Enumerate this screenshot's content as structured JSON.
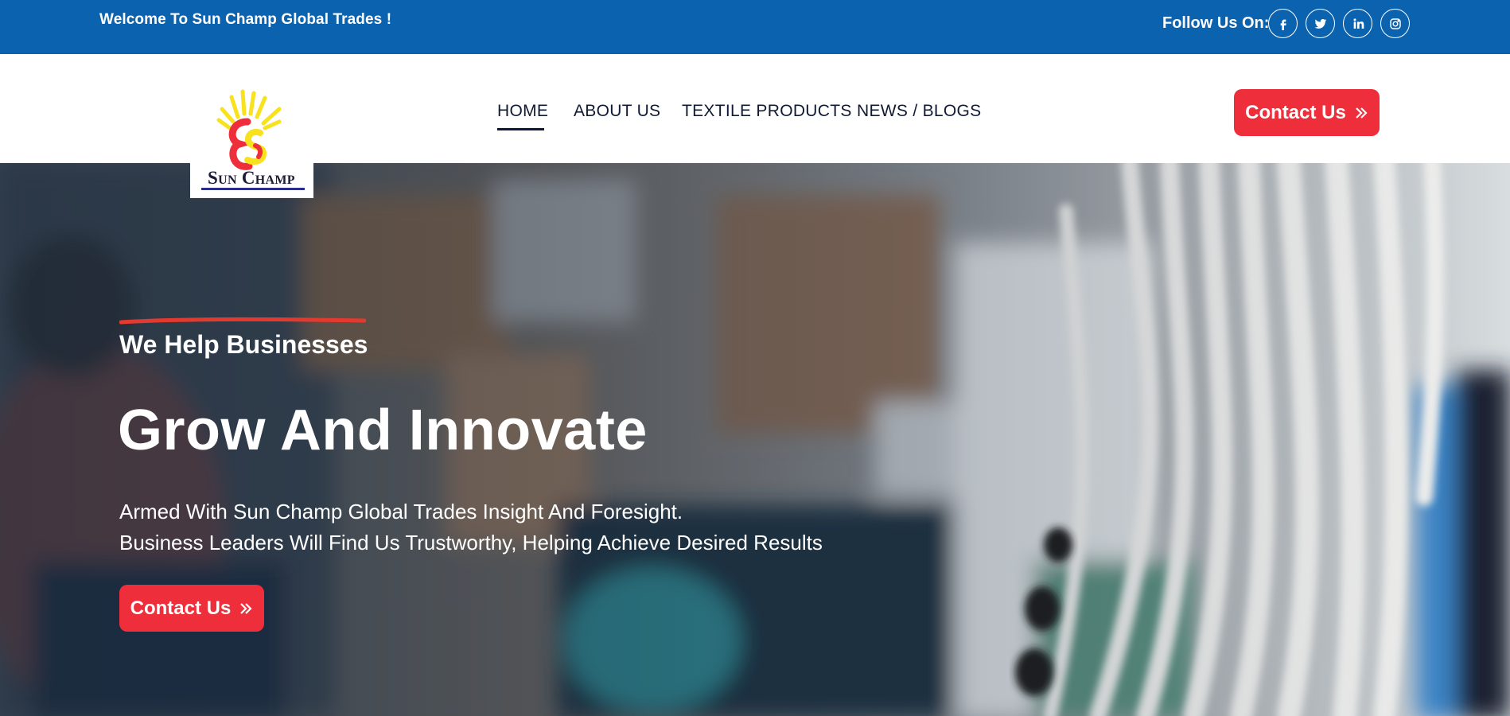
{
  "topbar": {
    "welcome": "Welcome To Sun Champ Global Trades !",
    "follow_label": "Follow Us On:",
    "social": [
      {
        "name": "facebook-icon"
      },
      {
        "name": "twitter-icon"
      },
      {
        "name": "linkedin-icon"
      },
      {
        "name": "instagram-icon"
      }
    ]
  },
  "logo": {
    "text": "Sun Champ"
  },
  "nav": {
    "items": [
      {
        "label": "HOME",
        "active": true
      },
      {
        "label": "ABOUT US"
      },
      {
        "label": "TEXTILE PRODUCTS"
      },
      {
        "label": "NEWS / BLOGS"
      }
    ],
    "contact_button": "Contact Us"
  },
  "hero": {
    "subtitle": "We Help Businesses",
    "headline": "Grow And Innovate",
    "description_line1": "Armed With Sun Champ Global Trades Insight And Foresight.",
    "description_line2": "Business Leaders Will Find Us Trustworthy, Helping Achieve Desired Results",
    "cta_button": "Contact Us"
  },
  "colors": {
    "topbar": "#0b63b0",
    "accent": "#ee2f3b",
    "nav_text": "#111a33"
  }
}
